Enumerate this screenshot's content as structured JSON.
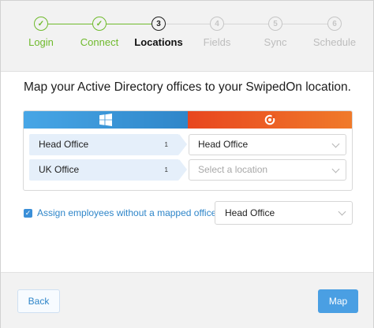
{
  "stepper": {
    "steps": [
      {
        "number": "✓",
        "label": "Login",
        "state": "done"
      },
      {
        "number": "✓",
        "label": "Connect",
        "state": "done"
      },
      {
        "number": "3",
        "label": "Locations",
        "state": "active"
      },
      {
        "number": "4",
        "label": "Fields",
        "state": "todo"
      },
      {
        "number": "5",
        "label": "Sync",
        "state": "todo"
      },
      {
        "number": "6",
        "label": "Schedule",
        "state": "todo"
      }
    ]
  },
  "prompt": "Map your Active Directory offices to your SwipedOn location.",
  "panel": {
    "left_icon": "windows-icon",
    "right_icon": "swipedon-logo-icon",
    "rows": [
      {
        "office": "Head Office",
        "count": "1",
        "location": "Head Office",
        "placeholder": ""
      },
      {
        "office": "UK Office",
        "count": "1",
        "location": "",
        "placeholder": "Select a location"
      }
    ]
  },
  "assign": {
    "checked": true,
    "label": "Assign employees without a mapped office to",
    "value": "Head Office"
  },
  "footer": {
    "back_label": "Back",
    "map_label": "Map"
  },
  "colors": {
    "done": "#6fba2c",
    "accent": "#2f86c9",
    "windows_blue": "#3a93d6",
    "swipedon_orange": "#ea5a22"
  }
}
